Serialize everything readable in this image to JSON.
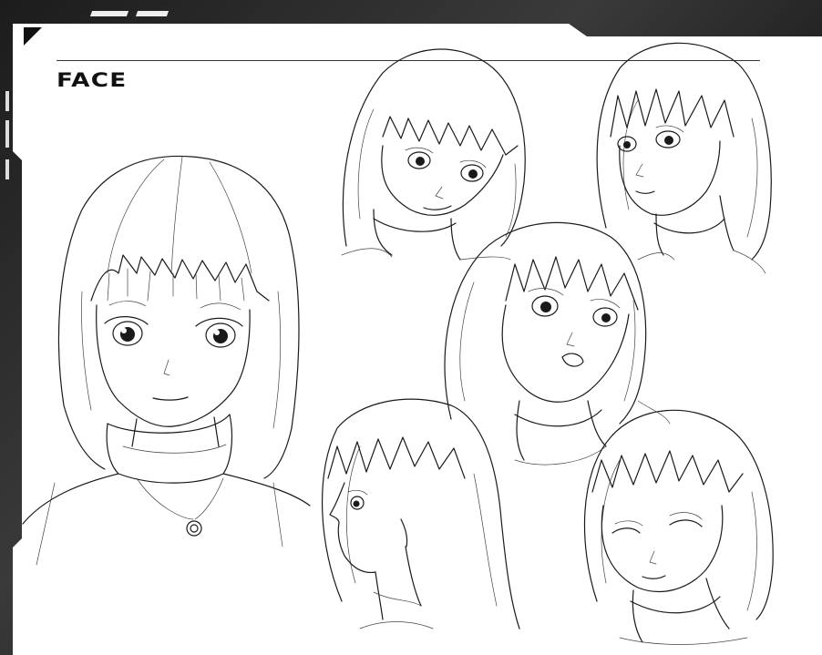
{
  "sheet": {
    "title": "FACE"
  },
  "drawings": [
    {
      "id": "front-large"
    },
    {
      "id": "three-quarter-top"
    },
    {
      "id": "three-quarter-right-top"
    },
    {
      "id": "three-quarter-surprised"
    },
    {
      "id": "profile-left"
    },
    {
      "id": "downward-look"
    }
  ],
  "colors": {
    "frame": "#2a2a2a",
    "paper": "#ffffff",
    "ink": "#1a1a1a"
  }
}
